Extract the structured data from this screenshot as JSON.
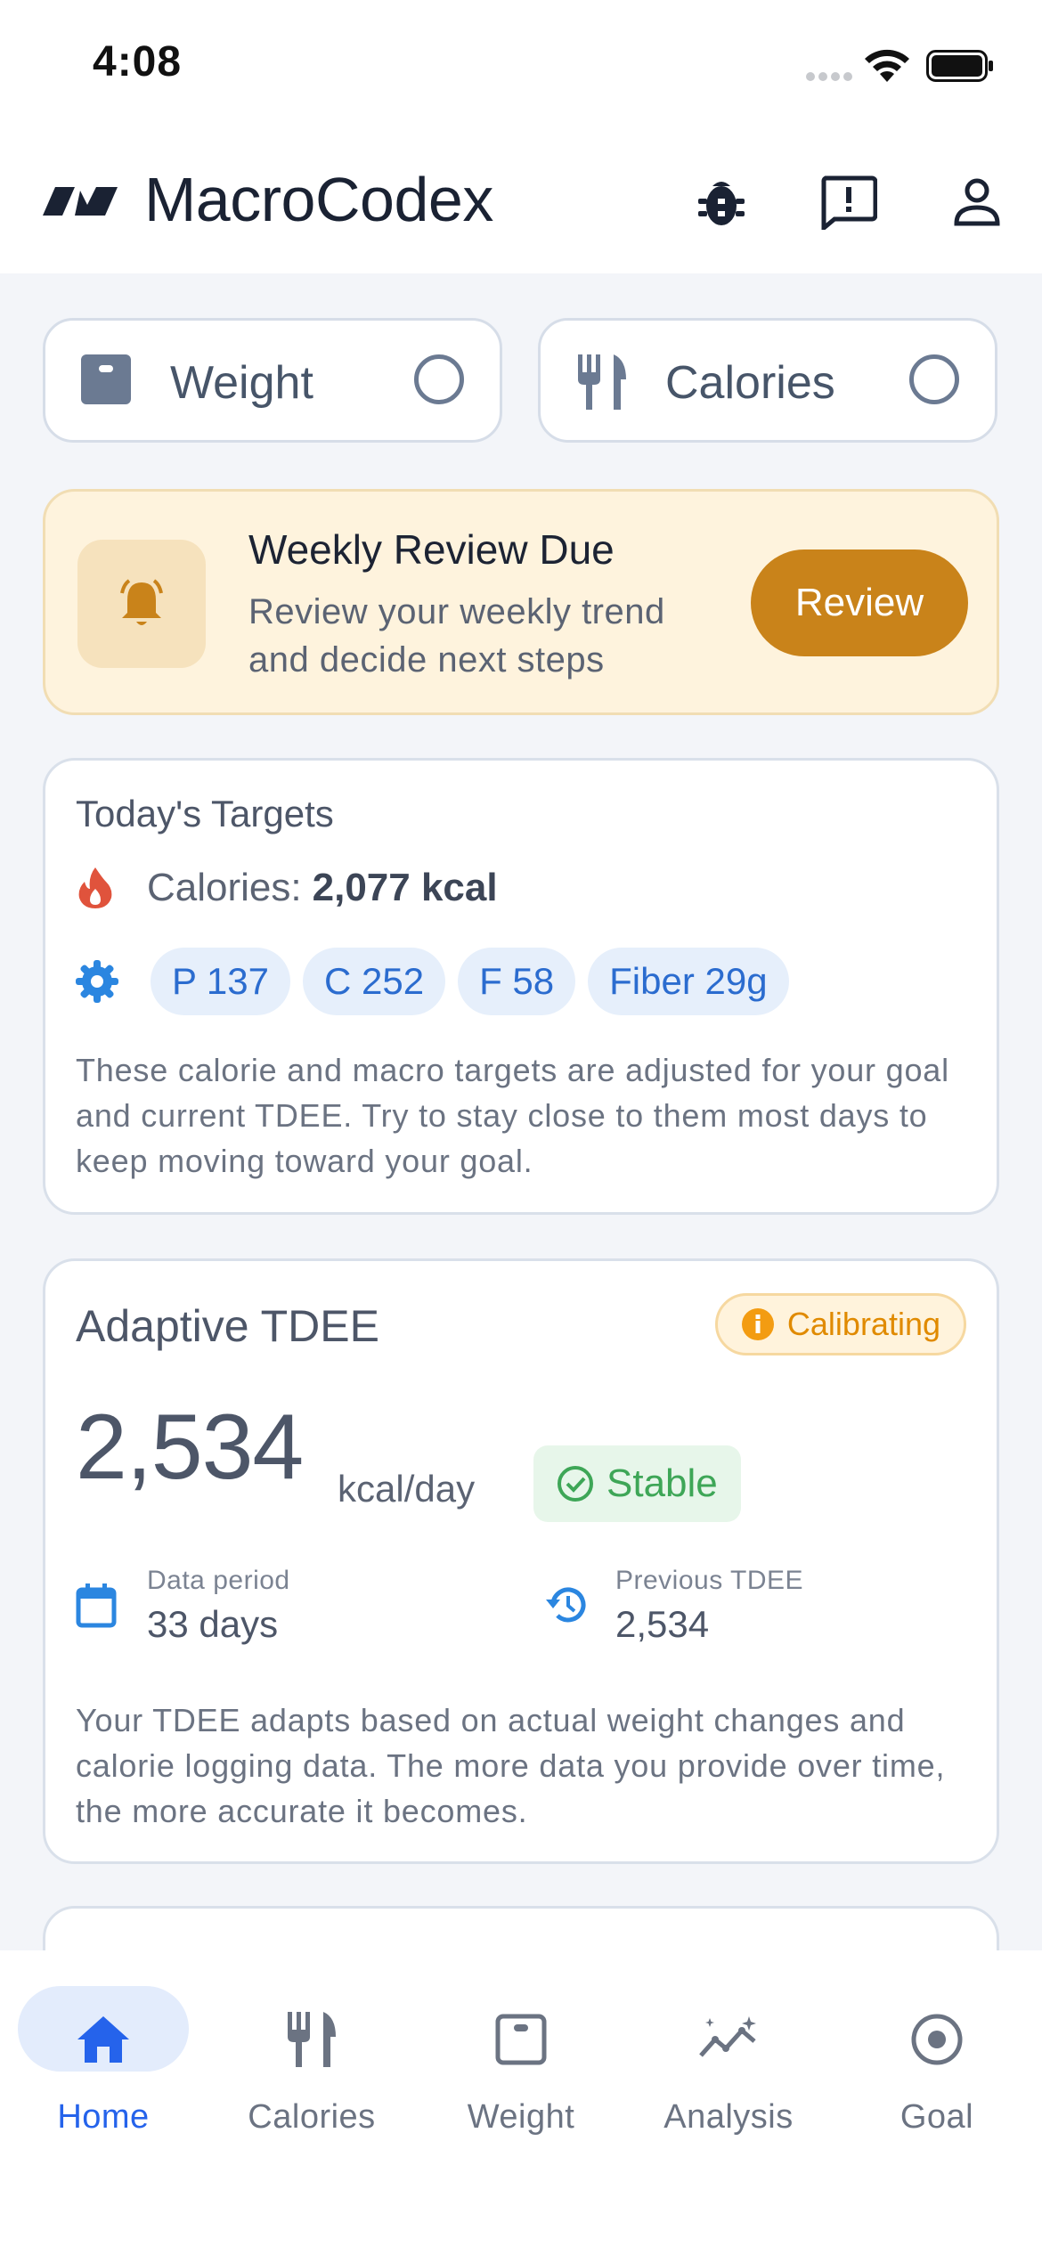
{
  "status_bar": {
    "time": "4:08"
  },
  "header": {
    "app_title": "MacroCodex"
  },
  "toggles": [
    {
      "label": "Weight",
      "icon": "scale-icon",
      "checked": false
    },
    {
      "label": "Calories",
      "icon": "utensils-icon",
      "checked": false
    }
  ],
  "review_banner": {
    "title": "Weekly Review Due",
    "subtitle": "Review your weekly trend and decide next steps",
    "button": "Review"
  },
  "targets": {
    "title": "Today's Targets",
    "calories_label": "Calories:",
    "calories_value": "2,077 kcal",
    "macros": [
      "P 137",
      "C 252",
      "F 58",
      "Fiber 29g"
    ],
    "note": "These calorie and macro targets are adjusted for your goal and current TDEE. Try to stay close to them most days to keep moving toward your goal."
  },
  "tdee": {
    "title": "Adaptive TDEE",
    "badge": "Calibrating",
    "value": "2,534",
    "unit": "kcal/day",
    "status": "Stable",
    "data_period_label": "Data period",
    "data_period_value": "33 days",
    "previous_label": "Previous TDEE",
    "previous_value": "2,534",
    "note": "Your TDEE adapts based on actual weight changes and calorie logging data. The more data you provide over time, the more accurate it becomes."
  },
  "nav": {
    "items": [
      {
        "label": "Home",
        "icon": "home-icon",
        "active": true
      },
      {
        "label": "Calories",
        "icon": "utensils-icon",
        "active": false
      },
      {
        "label": "Weight",
        "icon": "scale-icon",
        "active": false
      },
      {
        "label": "Analysis",
        "icon": "analysis-icon",
        "active": false
      },
      {
        "label": "Goal",
        "icon": "target-icon",
        "active": false
      }
    ]
  },
  "colors": {
    "accent_blue": "#2563eb",
    "review_orange": "#c9831a",
    "calibrating_orange": "#e08a00",
    "stable_green": "#3ea657",
    "flame_red": "#e0533c"
  }
}
